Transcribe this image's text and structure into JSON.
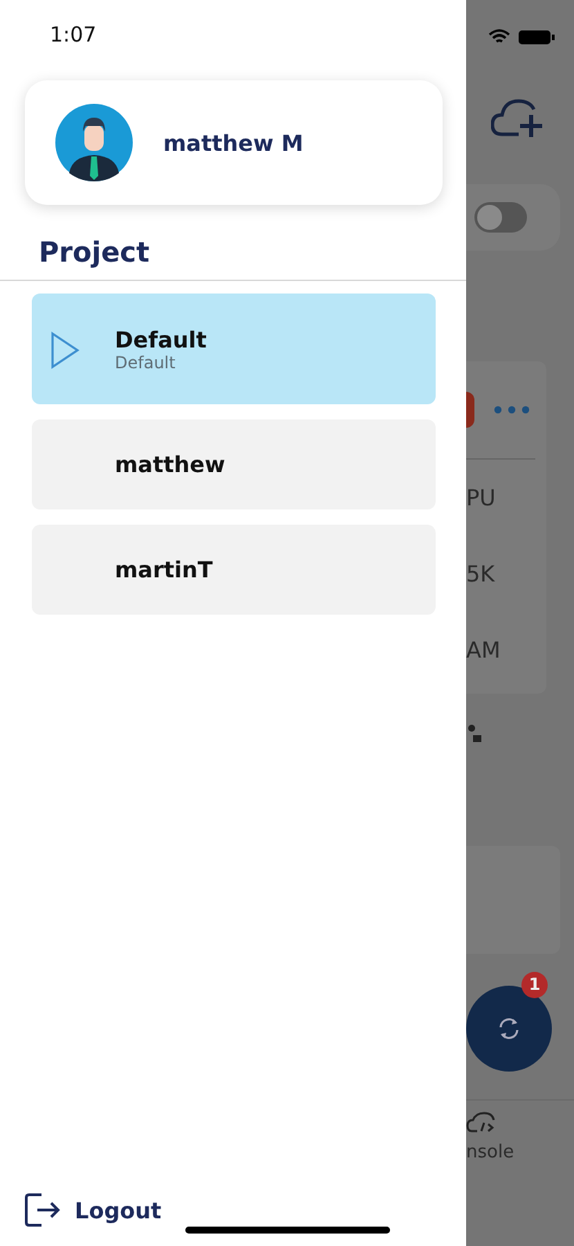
{
  "status_bar": {
    "time": "1:07"
  },
  "profile": {
    "name": "matthew M"
  },
  "project_section": {
    "title": "Project"
  },
  "projects": [
    {
      "name": "Default",
      "subtitle": "Default",
      "selected": true
    },
    {
      "name": "matthew",
      "selected": false
    },
    {
      "name": "martinT",
      "selected": false
    }
  ],
  "logout": {
    "label": "Logout"
  },
  "background_screen": {
    "toggle": {
      "on": false
    },
    "stats": [
      "PU",
      "5K",
      "AM"
    ],
    "sync_badge": "1",
    "nav_label": "nsole"
  }
}
